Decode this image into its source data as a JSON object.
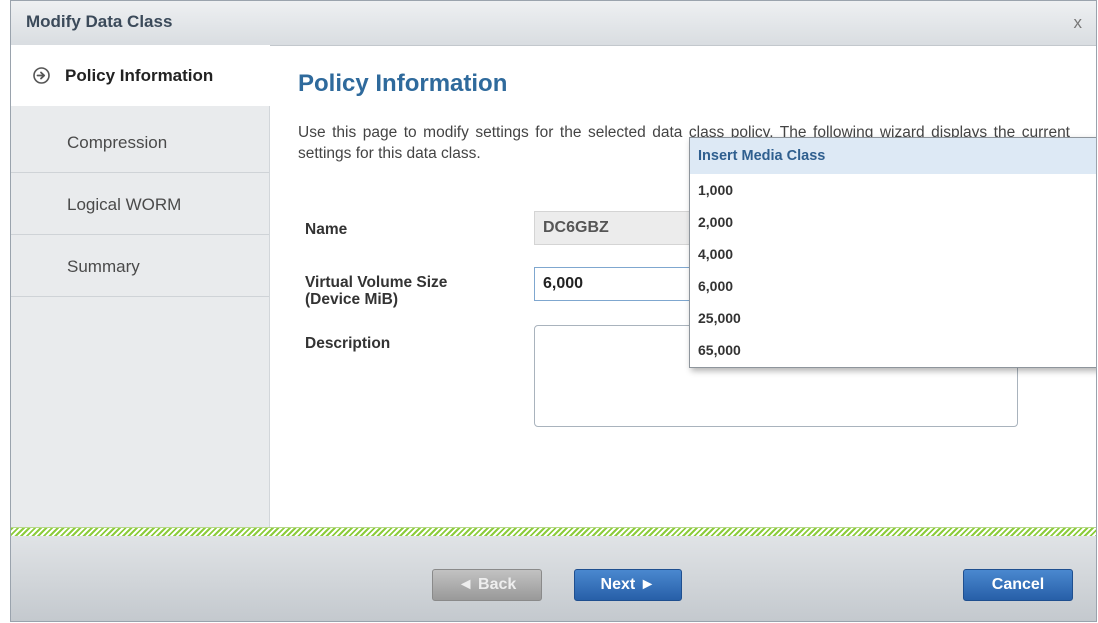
{
  "dialog": {
    "title": "Modify Data Class",
    "close_label": "x"
  },
  "steps": [
    {
      "label": "Policy Information",
      "active": true
    },
    {
      "label": "Compression"
    },
    {
      "label": "Logical WORM"
    },
    {
      "label": "Summary"
    }
  ],
  "main": {
    "heading": "Policy Information",
    "intro": "Use this page to modify settings for the selected data class policy. The following wizard displays the current settings for this data class."
  },
  "form": {
    "name_label": "Name",
    "name_value": "DC6GBZ",
    "size_label_line1": "Virtual Volume Size",
    "size_label_line2": "(Device MiB)",
    "size_value": "6,000",
    "description_label": "Description",
    "description_value": ""
  },
  "dropdown": {
    "header": "Insert Media Class",
    "options": [
      "1,000",
      "2,000",
      "4,000",
      "6,000",
      "25,000",
      "65,000"
    ]
  },
  "footer": {
    "back_label": "◄ Back",
    "next_label": "Next ►",
    "cancel_label": "Cancel"
  },
  "colors": {
    "accent": "#2f6a9c",
    "primary_button": "#275fa8",
    "divider": "#8ccc3c"
  }
}
